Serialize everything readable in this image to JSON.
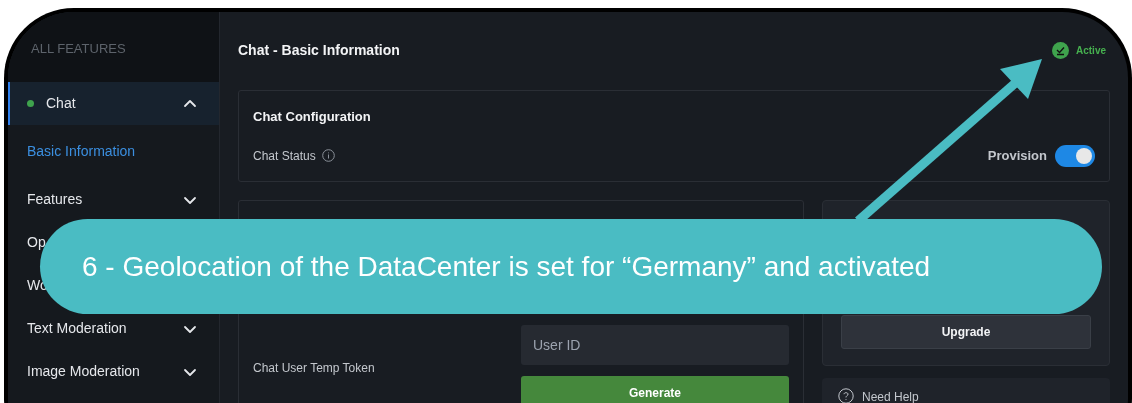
{
  "sidebar": {
    "header": "ALL FEATURES",
    "items": [
      {
        "label": "Chat",
        "selected": true,
        "expanded": true,
        "children": [
          {
            "label": "Basic Information",
            "selected": true
          }
        ]
      },
      {
        "label": "Features",
        "selected": false,
        "expanded": false
      },
      {
        "label": "Op",
        "selected": false,
        "expanded": false
      },
      {
        "label": "Wo",
        "selected": false,
        "expanded": false
      },
      {
        "label": "Text Moderation",
        "selected": false,
        "expanded": false
      },
      {
        "label": "Image Moderation",
        "selected": false,
        "expanded": false
      }
    ]
  },
  "page": {
    "title": "Chat - Basic Information",
    "status": "Active"
  },
  "configuration": {
    "title": "Chat Configuration",
    "label": "Chat Status",
    "toggle": {
      "label": "Provision",
      "on": true
    }
  },
  "token": {
    "label": "Chat User Temp Token",
    "placeholder": "User ID",
    "button": "Generate"
  },
  "plan": {
    "button": "Upgrade"
  },
  "help": {
    "label": "Need Help"
  },
  "annotation": {
    "text": "6 - Geolocation of the DataCenter is set for “Germany” and activated"
  }
}
